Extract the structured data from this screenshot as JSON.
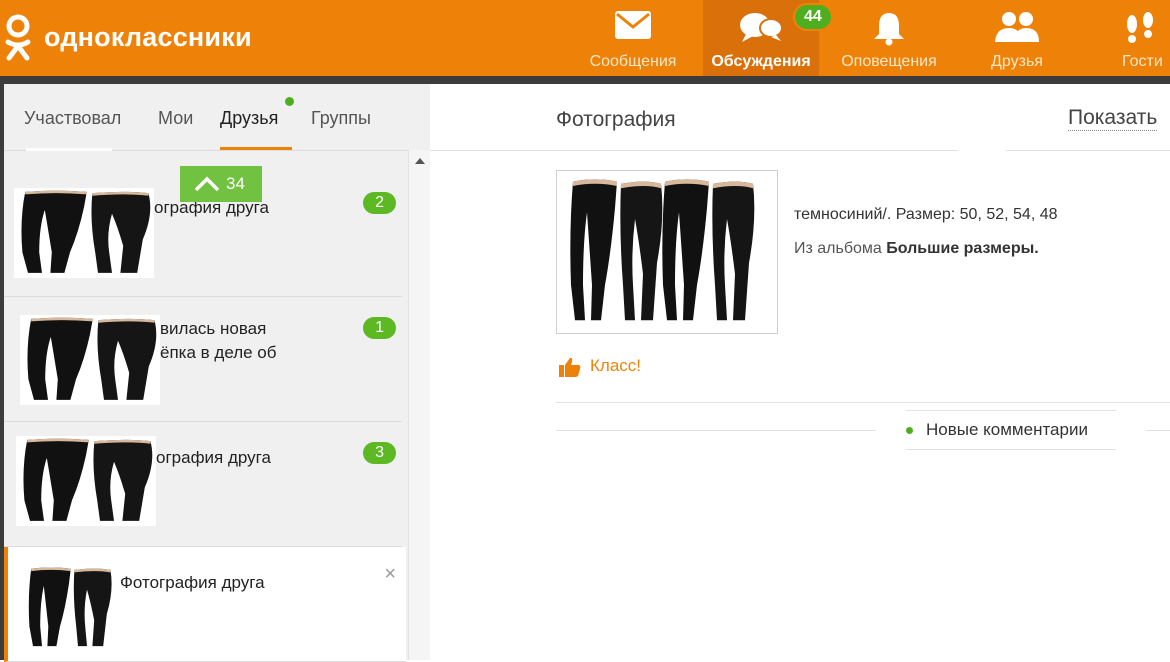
{
  "header": {
    "logo_text": "одноклассники",
    "nav": [
      {
        "label": "Сообщения",
        "icon": "envelope-icon"
      },
      {
        "label": "Обсуждения",
        "icon": "chat-bubbles-icon",
        "badge": "44",
        "active": true
      },
      {
        "label": "Оповещения",
        "icon": "bell-icon"
      },
      {
        "label": "Друзья",
        "icon": "friends-icon"
      },
      {
        "label": "Гости",
        "icon": "footprints-icon"
      }
    ]
  },
  "tabs": [
    {
      "label": "Участвовал"
    },
    {
      "label": "Мои"
    },
    {
      "label": "Друзья",
      "active": true
    },
    {
      "label": "Группы"
    }
  ],
  "scroll_up": {
    "count": "34",
    "icon": "chevron-up-icon"
  },
  "discussions": [
    {
      "title": "ография друга",
      "count": "2"
    },
    {
      "title_line1": "вилась новая",
      "title_line2": "ёпка в деле об",
      "count": "1"
    },
    {
      "title": "ография друга",
      "count": "3"
    },
    {
      "title": "Фотография друга",
      "close": "×",
      "selected": true
    }
  ],
  "detail": {
    "title": "Фотография",
    "show_label": "Показать",
    "description": "темносиний/.            Размер: 50, 52, 54, 48",
    "album_prefix": "Из альбома",
    "album_name": "Большие размеры.",
    "like_label": "Класс!",
    "new_comments_label": "Новые комментарии"
  },
  "colors": {
    "brand_orange": "#ee8208",
    "badge_green": "#4fae1f",
    "count_green": "#5cb923"
  }
}
